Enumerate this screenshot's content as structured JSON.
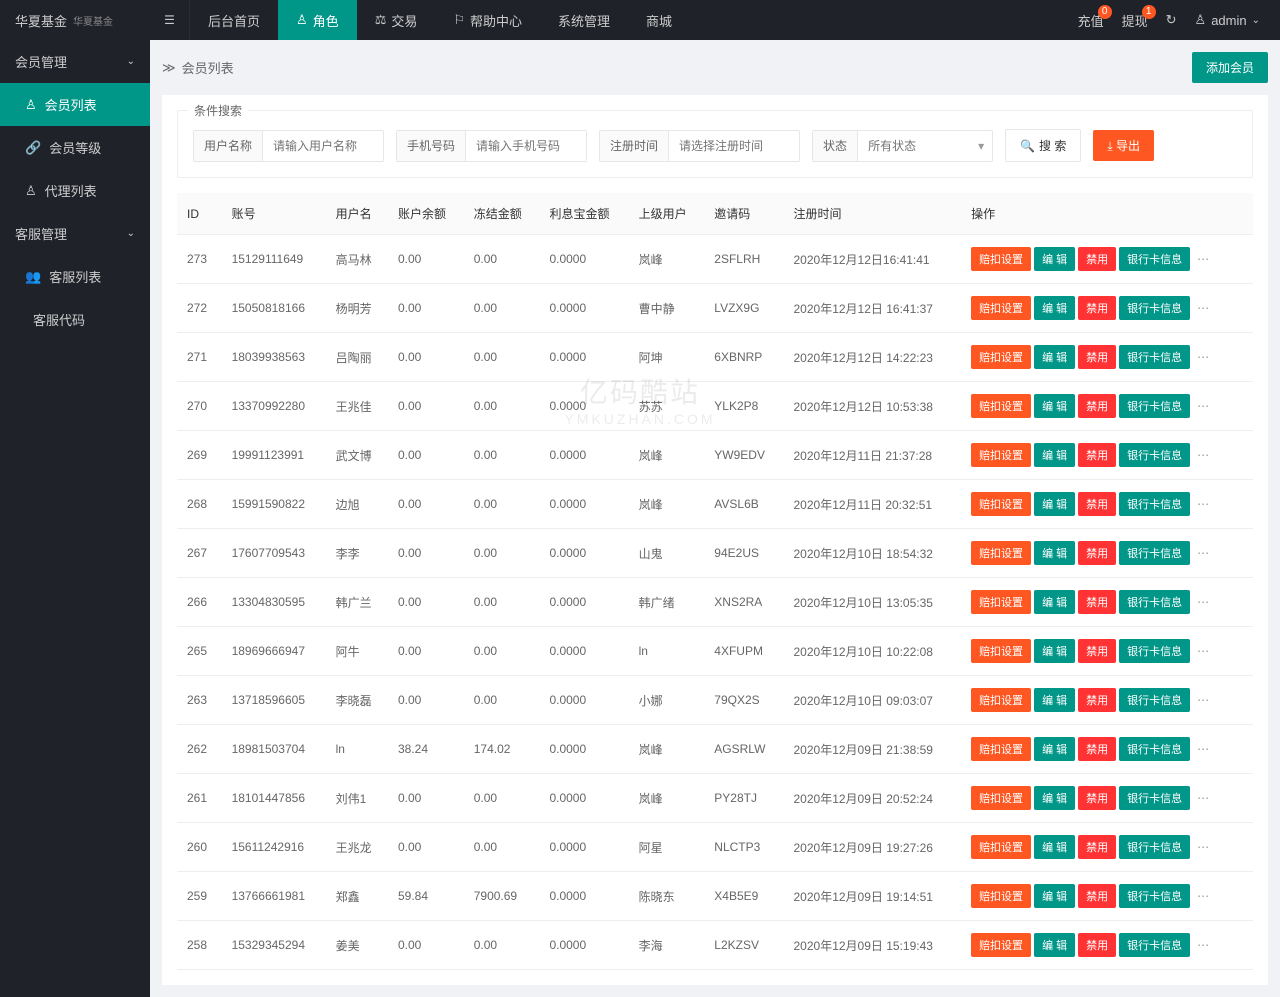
{
  "brand": {
    "name": "华夏基金",
    "sub": "华夏基金"
  },
  "topnav": {
    "items": [
      {
        "label": "后台首页",
        "icon": ""
      },
      {
        "label": "角色",
        "icon": "user",
        "active": true
      },
      {
        "label": "交易",
        "icon": "scale"
      },
      {
        "label": "帮助中心",
        "icon": "flag"
      },
      {
        "label": "系统管理",
        "icon": ""
      },
      {
        "label": "商城",
        "icon": ""
      }
    ]
  },
  "topRight": {
    "recharge": {
      "label": "充值",
      "badge": "0"
    },
    "withdraw": {
      "label": "提现",
      "badge": "1"
    },
    "user": "admin"
  },
  "sidebar": {
    "groups": [
      {
        "label": "会员管理",
        "open": true,
        "items": [
          {
            "label": "会员列表",
            "icon": "user",
            "active": true
          },
          {
            "label": "会员等级",
            "icon": "link"
          },
          {
            "label": "代理列表",
            "icon": "user"
          }
        ]
      },
      {
        "label": "客服管理",
        "open": true,
        "items": [
          {
            "label": "客服列表",
            "icon": "people"
          },
          {
            "label": "客服代码",
            "icon": "code"
          }
        ]
      }
    ]
  },
  "breadcrumb": {
    "title": "会员列表",
    "addBtn": "添加会员"
  },
  "search": {
    "legend": "条件搜索",
    "fields": {
      "username": {
        "label": "用户名称",
        "placeholder": "请输入用户名称"
      },
      "phone": {
        "label": "手机号码",
        "placeholder": "请输入手机号码"
      },
      "regtime": {
        "label": "注册时间",
        "placeholder": "请选择注册时间"
      },
      "status": {
        "label": "状态",
        "placeholder": "所有状态"
      }
    },
    "searchBtn": "搜 索",
    "exportBtn": "导出"
  },
  "table": {
    "columns": [
      "ID",
      "账号",
      "用户名",
      "账户余额",
      "冻结金额",
      "利息宝金额",
      "上级用户",
      "邀请码",
      "注册时间",
      "操作"
    ],
    "actions": {
      "a1": "赔扣设置",
      "a2": "编 辑",
      "a3": "禁用",
      "a4": "银行卡信息"
    },
    "rows": [
      {
        "id": "273",
        "acct": "15129111649",
        "name": "高马林",
        "bal": "0.00",
        "frozen": "0.00",
        "interest": "0.0000",
        "parent": "岚峰",
        "code": "2SFLRH",
        "time": "2020年12月12日16:41:41"
      },
      {
        "id": "272",
        "acct": "15050818166",
        "name": "杨明芳",
        "bal": "0.00",
        "frozen": "0.00",
        "interest": "0.0000",
        "parent": "曹中静",
        "code": "LVZX9G",
        "time": "2020年12月12日 16:41:37"
      },
      {
        "id": "271",
        "acct": "18039938563",
        "name": "吕陶丽",
        "bal": "0.00",
        "frozen": "0.00",
        "interest": "0.0000",
        "parent": "阿坤",
        "code": "6XBNRP",
        "time": "2020年12月12日 14:22:23"
      },
      {
        "id": "270",
        "acct": "13370992280",
        "name": "王兆佳",
        "bal": "0.00",
        "frozen": "0.00",
        "interest": "0.0000",
        "parent": "苏苏",
        "code": "YLK2P8",
        "time": "2020年12月12日 10:53:38"
      },
      {
        "id": "269",
        "acct": "19991123991",
        "name": "武文博",
        "bal": "0.00",
        "frozen": "0.00",
        "interest": "0.0000",
        "parent": "岚峰",
        "code": "YW9EDV",
        "time": "2020年12月11日 21:37:28"
      },
      {
        "id": "268",
        "acct": "15991590822",
        "name": "边旭",
        "bal": "0.00",
        "frozen": "0.00",
        "interest": "0.0000",
        "parent": "岚峰",
        "code": "AVSL6B",
        "time": "2020年12月11日 20:32:51"
      },
      {
        "id": "267",
        "acct": "17607709543",
        "name": "李李",
        "bal": "0.00",
        "frozen": "0.00",
        "interest": "0.0000",
        "parent": "山鬼",
        "code": "94E2US",
        "time": "2020年12月10日 18:54:32"
      },
      {
        "id": "266",
        "acct": "13304830595",
        "name": "韩广兰",
        "bal": "0.00",
        "frozen": "0.00",
        "interest": "0.0000",
        "parent": "韩广绪",
        "code": "XNS2RA",
        "time": "2020年12月10日 13:05:35"
      },
      {
        "id": "265",
        "acct": "18969666947",
        "name": "阿牛",
        "bal": "0.00",
        "frozen": "0.00",
        "interest": "0.0000",
        "parent": "ln",
        "code": "4XFUPM",
        "time": "2020年12月10日 10:22:08"
      },
      {
        "id": "263",
        "acct": "13718596605",
        "name": "李晓磊",
        "bal": "0.00",
        "frozen": "0.00",
        "interest": "0.0000",
        "parent": "小娜",
        "code": "79QX2S",
        "time": "2020年12月10日 09:03:07"
      },
      {
        "id": "262",
        "acct": "18981503704",
        "name": "ln",
        "bal": "38.24",
        "frozen": "174.02",
        "interest": "0.0000",
        "parent": "岚峰",
        "code": "AGSRLW",
        "time": "2020年12月09日 21:38:59"
      },
      {
        "id": "261",
        "acct": "18101447856",
        "name": "刘伟1",
        "bal": "0.00",
        "frozen": "0.00",
        "interest": "0.0000",
        "parent": "岚峰",
        "code": "PY28TJ",
        "time": "2020年12月09日 20:52:24"
      },
      {
        "id": "260",
        "acct": "15611242916",
        "name": "王兆龙",
        "bal": "0.00",
        "frozen": "0.00",
        "interest": "0.0000",
        "parent": "阿星",
        "code": "NLCTP3",
        "time": "2020年12月09日 19:27:26"
      },
      {
        "id": "259",
        "acct": "13766661981",
        "name": "郑鑫",
        "bal": "59.84",
        "frozen": "7900.69",
        "interest": "0.0000",
        "parent": "陈晓东",
        "code": "X4B5E9",
        "time": "2020年12月09日 19:14:51"
      },
      {
        "id": "258",
        "acct": "15329345294",
        "name": "姜美",
        "bal": "0.00",
        "frozen": "0.00",
        "interest": "0.0000",
        "parent": "李海",
        "code": "L2KZSV",
        "time": "2020年12月09日 15:19:43"
      }
    ]
  },
  "watermark": {
    "main": "亿码酷站",
    "sub": "YMKUZHAN.COM"
  }
}
